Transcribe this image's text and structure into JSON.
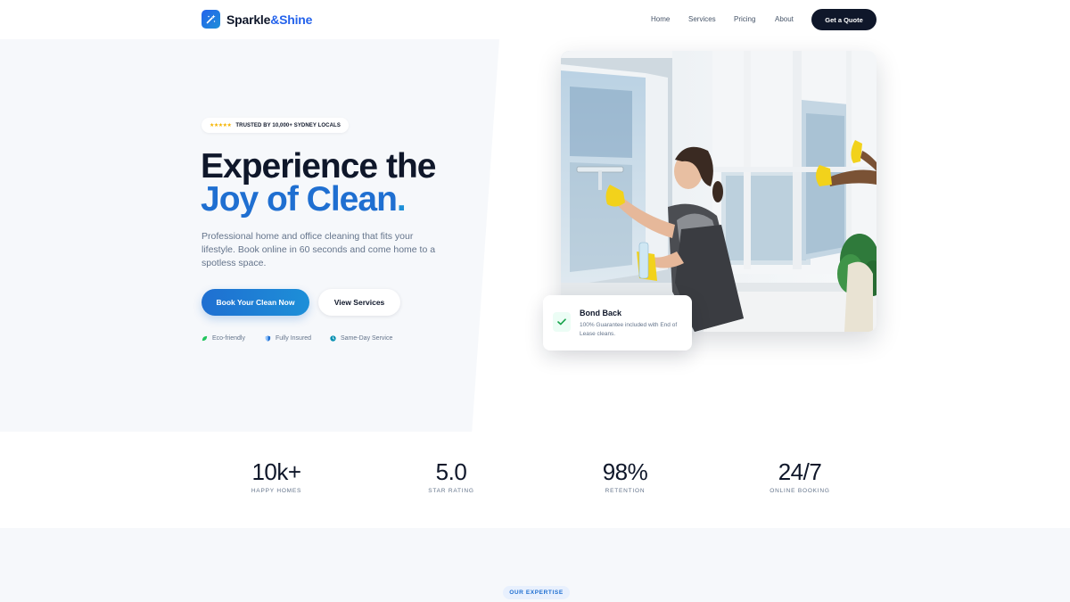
{
  "brand": {
    "name_part1": "Sparkle",
    "name_part2": "&Shine",
    "logo_icon": "sparkle-wand-icon",
    "accent_color": "#2563eb"
  },
  "nav": {
    "links": [
      "Home",
      "Services",
      "Pricing",
      "About"
    ],
    "cta": "Get a Quote"
  },
  "hero": {
    "trust_stars": "★★★★★",
    "trust_text": "TRUSTED BY 10,000+ SYDNEY LOCALS",
    "headline_line1": "Experience the",
    "headline_line2": "Joy of Clean",
    "headline_dot": ".",
    "lead": "Professional home and office cleaning that fits your lifestyle. Book online in 60 seconds and come home to a spotless space.",
    "primary_button": "Book Your Clean Now",
    "secondary_button": "View Services",
    "features": [
      {
        "icon": "leaf-icon",
        "label": "Eco-friendly",
        "color": "#22c55e"
      },
      {
        "icon": "shield-icon",
        "label": "Fully Insured",
        "color": "#1f6fd1"
      },
      {
        "icon": "clock-icon",
        "label": "Same-Day Service",
        "color": "#0891b2"
      }
    ]
  },
  "badge": {
    "icon": "check-icon",
    "title": "Bond Back",
    "text": "100% Guarantee included with End of Lease cleans."
  },
  "stats": [
    {
      "value": "10k+",
      "label": "HAPPY HOMES"
    },
    {
      "value": "5.0",
      "label": "STAR RATING"
    },
    {
      "value": "98%",
      "label": "RETENTION"
    },
    {
      "value": "24/7",
      "label": "ONLINE BOOKING"
    }
  ],
  "expertise": {
    "eyebrow": "OUR EXPERTISE"
  }
}
